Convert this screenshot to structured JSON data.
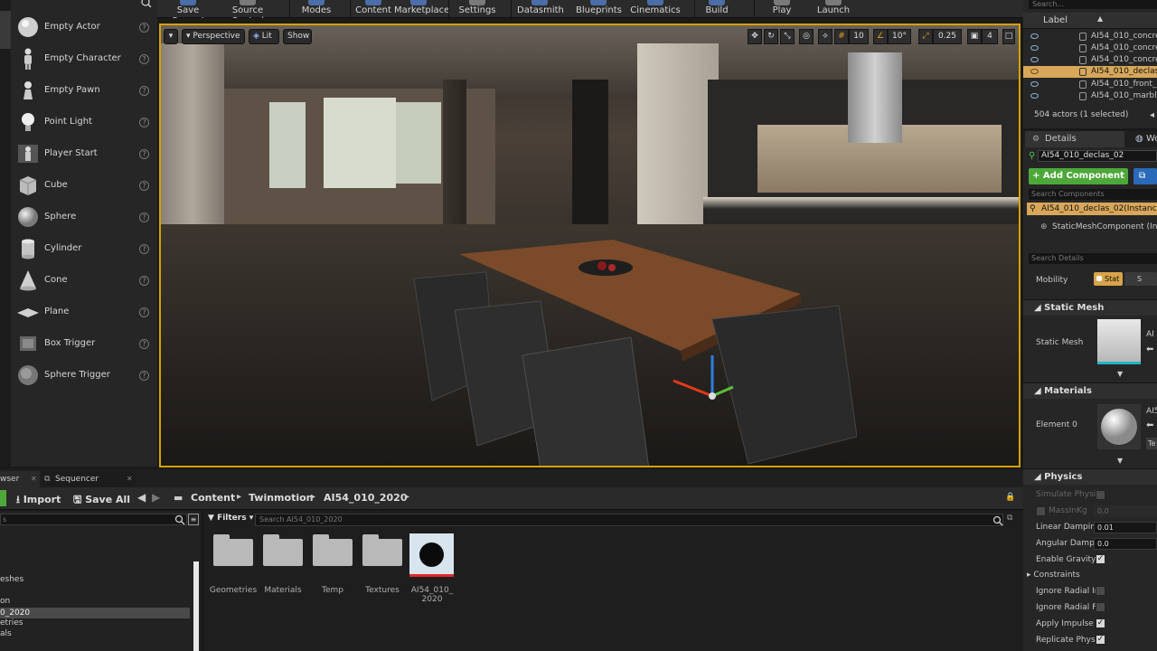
{
  "toolbar": {
    "items": [
      "Save Current",
      "Source Control",
      "Modes",
      "Content",
      "Marketplace",
      "Settings",
      "Datasmith",
      "Blueprints",
      "Cinematics",
      "Build",
      "Play",
      "Launch"
    ]
  },
  "place_panel": {
    "items": [
      {
        "label": "Empty Actor"
      },
      {
        "label": "Empty Character"
      },
      {
        "label": "Empty Pawn"
      },
      {
        "label": "Point Light"
      },
      {
        "label": "Player Start"
      },
      {
        "label": "Cube"
      },
      {
        "label": "Sphere"
      },
      {
        "label": "Cylinder"
      },
      {
        "label": "Cone"
      },
      {
        "label": "Plane"
      },
      {
        "label": "Box Trigger"
      },
      {
        "label": "Sphere Trigger"
      }
    ],
    "help_glyph": "?"
  },
  "viewport": {
    "view_mode": "Perspective",
    "lighting": "Lit",
    "show": "Show",
    "grid_snap": "10",
    "rot_snap": "10°",
    "scale_snap": "0.25",
    "camera_speed": "4"
  },
  "outliner": {
    "search_placeholder": "Search...",
    "column": "Label",
    "rows": [
      {
        "label": "AI54_010_concret",
        "selected": false
      },
      {
        "label": "AI54_010_concret",
        "selected": false
      },
      {
        "label": "AI54_010_concret",
        "selected": false
      },
      {
        "label": "AI54_010_declas_",
        "selected": true
      },
      {
        "label": "AI54_010_front_0",
        "selected": false
      },
      {
        "label": "AI54_010_marble_",
        "selected": false
      }
    ],
    "status": "504 actors (1 selected)"
  },
  "details": {
    "tab": "Details",
    "tab2": "Wo",
    "actor_name": "AI54_010_declas_02",
    "add_component": "+ Add Component",
    "search_components": "Search Components",
    "instance": "AI54_010_declas_02(Instance)",
    "component": "StaticMeshComponent (Inhe",
    "search_details": "Search Details",
    "mobility_label": "Mobility",
    "mobility_value": "Stat",
    "mobility_value2": "S",
    "section_static_mesh": "Static Mesh",
    "static_mesh_label": "Static Mesh",
    "static_mesh_value": "AI",
    "section_materials": "Materials",
    "element0_label": "Element 0",
    "element0_value": "AI5",
    "element0_btn": "Te",
    "section_physics": "Physics",
    "physics": [
      {
        "label": "Simulate Physic",
        "type": "check",
        "value": false,
        "disabled": true
      },
      {
        "label": "MassInKg",
        "type": "num",
        "value": "0.0",
        "disabled": true
      },
      {
        "label": "Linear Damping",
        "type": "num",
        "value": "0.01"
      },
      {
        "label": "Angular Damping",
        "type": "num",
        "value": "0.0"
      },
      {
        "label": "Enable Gravity",
        "type": "check",
        "value": true
      },
      {
        "label": "Constraints",
        "type": "group"
      },
      {
        "label": "Ignore Radial Im",
        "type": "check",
        "value": false
      },
      {
        "label": "Ignore Radial For",
        "type": "check",
        "value": false
      },
      {
        "label": "Apply Impulse or",
        "type": "check",
        "value": true
      },
      {
        "label": "Replicate Physic",
        "type": "check",
        "value": true
      }
    ]
  },
  "content_browser": {
    "tabs": [
      "wser",
      "Sequencer"
    ],
    "import": "Import",
    "save_all": "Save All",
    "breadcrumb": [
      "Content",
      "Twinmotion",
      "AI54_010_2020"
    ],
    "filters": "Filters",
    "search_placeholder": "Search AI54_010_2020",
    "tree": [
      "eshes",
      "on",
      "0_2020",
      "etries",
      "als"
    ],
    "assets": [
      {
        "label": "Geometries",
        "kind": "folder"
      },
      {
        "label": "Materials",
        "kind": "folder"
      },
      {
        "label": "Temp",
        "kind": "folder"
      },
      {
        "label": "Textures",
        "kind": "folder"
      },
      {
        "label": "AI54_010_\n2020",
        "kind": "level"
      }
    ]
  }
}
